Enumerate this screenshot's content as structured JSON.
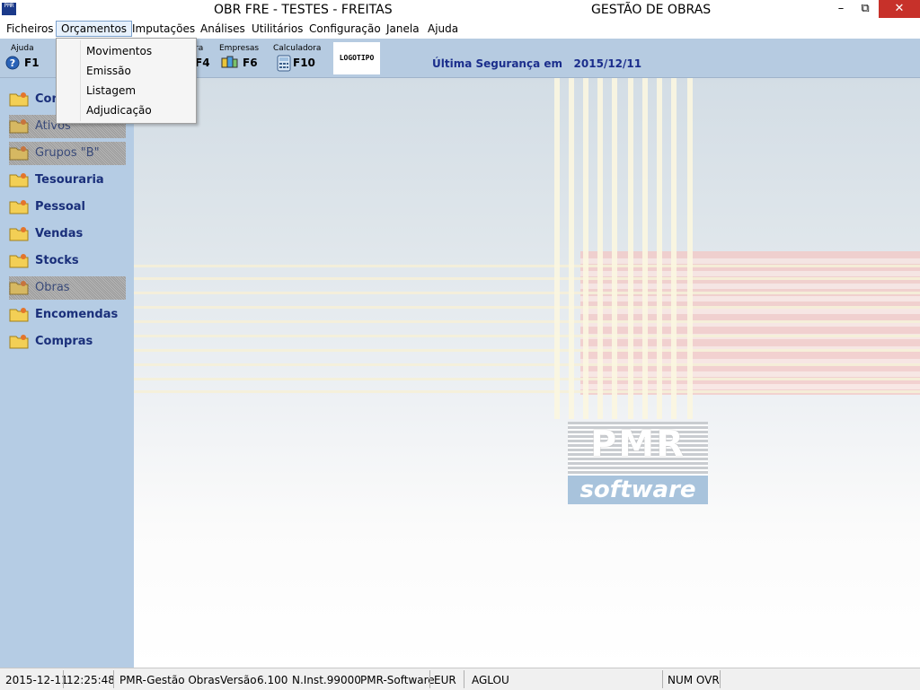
{
  "window": {
    "icon_text": "PMR",
    "title_left": "OBR FRE - TESTES - FREITAS",
    "title_right": "GESTÃO DE OBRAS"
  },
  "menu": {
    "items": [
      "Ficheiros",
      "Orçamentos",
      "Imputações",
      "Análises",
      "Utilitários",
      "Configuração",
      "Janela",
      "Ajuda"
    ],
    "active": "Orçamentos"
  },
  "dropdown": {
    "items": [
      "Movimentos",
      "Emissão",
      "Listagem",
      "Adjudicação"
    ]
  },
  "toolbar": {
    "help_label": "Ajuda",
    "help_key": "F1",
    "partial_label": "ra",
    "partial_key": "F4",
    "companies_label": "Empresas",
    "companies_key": "F6",
    "calculator_label": "Calculadora",
    "calculator_key": "F10",
    "logo_text": "LOGOTIPO",
    "last_security_label": "Última Segurança em",
    "last_security_date": "2015/12/11"
  },
  "sidebar": {
    "items": [
      {
        "label": "Con",
        "enabled": true
      },
      {
        "label": "Ativos",
        "enabled": false
      },
      {
        "label": "Grupos \"B\"",
        "enabled": false
      },
      {
        "label": "Tesouraria",
        "enabled": true
      },
      {
        "label": "Pessoal",
        "enabled": true
      },
      {
        "label": "Vendas",
        "enabled": true
      },
      {
        "label": "Stocks",
        "enabled": true
      },
      {
        "label": "Obras",
        "enabled": false
      },
      {
        "label": "Encomendas",
        "enabled": true
      },
      {
        "label": "Compras",
        "enabled": true
      }
    ]
  },
  "background_logo": {
    "letters": "PMR",
    "word": "software"
  },
  "statusbar": {
    "date": "2015-12-11",
    "time": "12:25:48",
    "app": "PMR-Gestão Obras",
    "version_label": "Versão",
    "version": "6.100",
    "inst": "N.Inst.99000",
    "vendor": "PMR-Software",
    "currency": "EUR",
    "user": "AGLOU",
    "keys": "NUM OVR"
  },
  "colors": {
    "toolbar_bg": "#b6cbe1",
    "sidebar_bg": "#b5cce4",
    "sidebar_text": "#1a2f7a",
    "close_button": "#c7312a"
  }
}
